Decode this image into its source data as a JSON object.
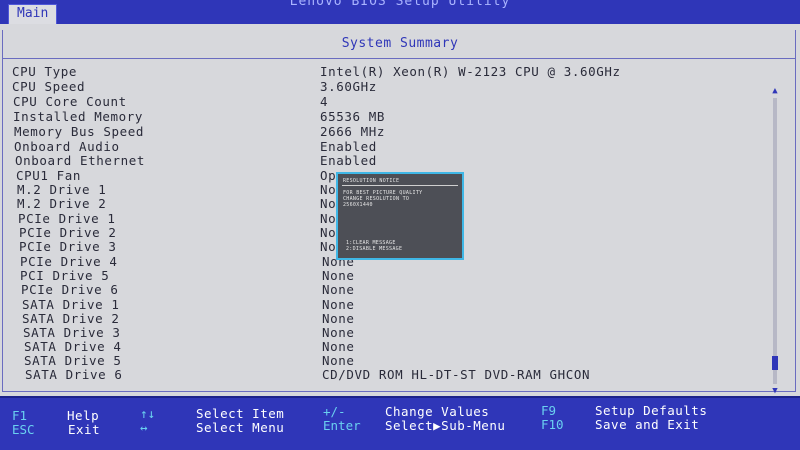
{
  "app": {
    "title": "Lenovo BIOS Setup Utility"
  },
  "tabs": [
    {
      "label": "Main"
    }
  ],
  "section": {
    "title": "System Summary"
  },
  "summary_rows": [
    {
      "label": "CPU Type",
      "value": "Intel(R) Xeon(R) W-2123 CPU @ 3.60GHz"
    },
    {
      "label": "CPU Speed",
      "value": "3.60GHz"
    },
    {
      "label": "CPU Core Count",
      "value": "4"
    },
    {
      "label": "Installed Memory",
      "value": "65536 MB"
    },
    {
      "label": "Memory Bus Speed",
      "value": "2666 MHz"
    },
    {
      "label": "Onboard Audio",
      "value": "Enabled"
    },
    {
      "label": "Onboard Ethernet",
      "value": "Enabled"
    },
    {
      "label": "CPU1 Fan",
      "value": "Op"
    },
    {
      "label": "M.2 Drive 1",
      "value": "No"
    },
    {
      "label": "M.2 Drive 2",
      "value": "No"
    },
    {
      "label": "PCIe Drive 1",
      "value": "No"
    },
    {
      "label": "PCIe Drive 2",
      "value": "No"
    },
    {
      "label": "PCIe Drive 3",
      "value": "No"
    },
    {
      "label": "PCIe Drive 4",
      "value": "None"
    },
    {
      "label": "PCI  Drive 5",
      "value": "None"
    },
    {
      "label": "PCIe Drive 6",
      "value": "None"
    },
    {
      "label": "SATA Drive 1",
      "value": "None"
    },
    {
      "label": "SATA Drive 2",
      "value": "None"
    },
    {
      "label": "SATA Drive 3",
      "value": "None"
    },
    {
      "label": "SATA Drive 4",
      "value": "None"
    },
    {
      "label": "SATA Drive 5",
      "value": "None"
    },
    {
      "label": "SATA Drive 6",
      "value": "CD/DVD ROM HL-DT-ST DVD-RAM GHCON"
    }
  ],
  "popup": {
    "title": "RESOLUTION NOTICE",
    "line1": "FOR BEST PICTURE QUALITY",
    "line2": "CHANGE RESOLUTION TO",
    "line3": "2560X1440",
    "option1": "1:CLEAR MESSAGE",
    "option2": "2:DISABLE MESSAGE"
  },
  "help": {
    "f1_key": "F1",
    "f1_desc": "Help",
    "esc_key": "ESC",
    "esc_desc": "Exit",
    "updown_key": "↑↓",
    "updown_desc": "Select Item",
    "leftright_key": "↔",
    "leftright_desc": "Select Menu",
    "plusminus_key": "+/-",
    "plusminus_desc": "Change Values",
    "enter_key": "Enter",
    "enter_desc": "Select▶Sub-Menu",
    "f9_key": "F9",
    "f9_desc": "Setup Defaults",
    "f10_key": "F10",
    "f10_desc": "Save and Exit"
  },
  "colors": {
    "bar_blue": "#2f36b8",
    "panel_gray": "#d7d8dc",
    "key_cyan": "#6ad0f0",
    "popup_border": "#3fb7e6"
  }
}
